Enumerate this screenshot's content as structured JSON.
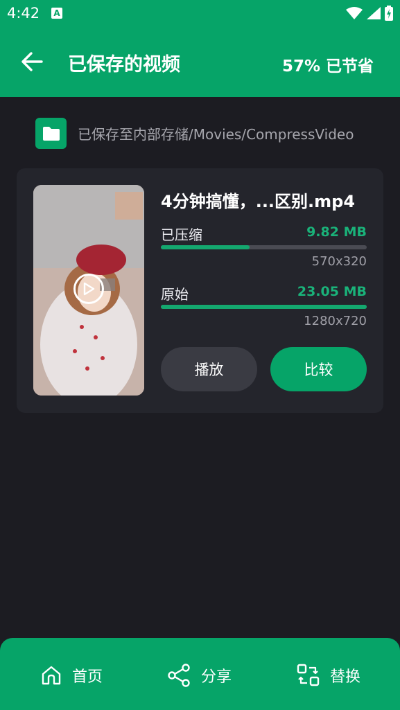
{
  "status": {
    "time": "4:42",
    "notif_icon": "A"
  },
  "appbar": {
    "title": "已保存的视频",
    "savings": "57% 已节省"
  },
  "save_path": "已保存至内部存储/Movies/CompressVideo",
  "video": {
    "filename": "4分钟搞懂，...区别.mp4",
    "compressed_label": "已压缩",
    "compressed_size": "9.82 MB",
    "compressed_fraction": 0.43,
    "compressed_res": "570x320",
    "original_label": "原始",
    "original_size": "23.05 MB",
    "original_fraction": 1.0,
    "original_res": "1280x720"
  },
  "buttons": {
    "play": "播放",
    "compare": "比较"
  },
  "nav": {
    "home": "首页",
    "share": "分享",
    "replace": "替换"
  },
  "colors": {
    "accent": "#06a468",
    "background": "#1c1c22",
    "card": "#24252c"
  }
}
